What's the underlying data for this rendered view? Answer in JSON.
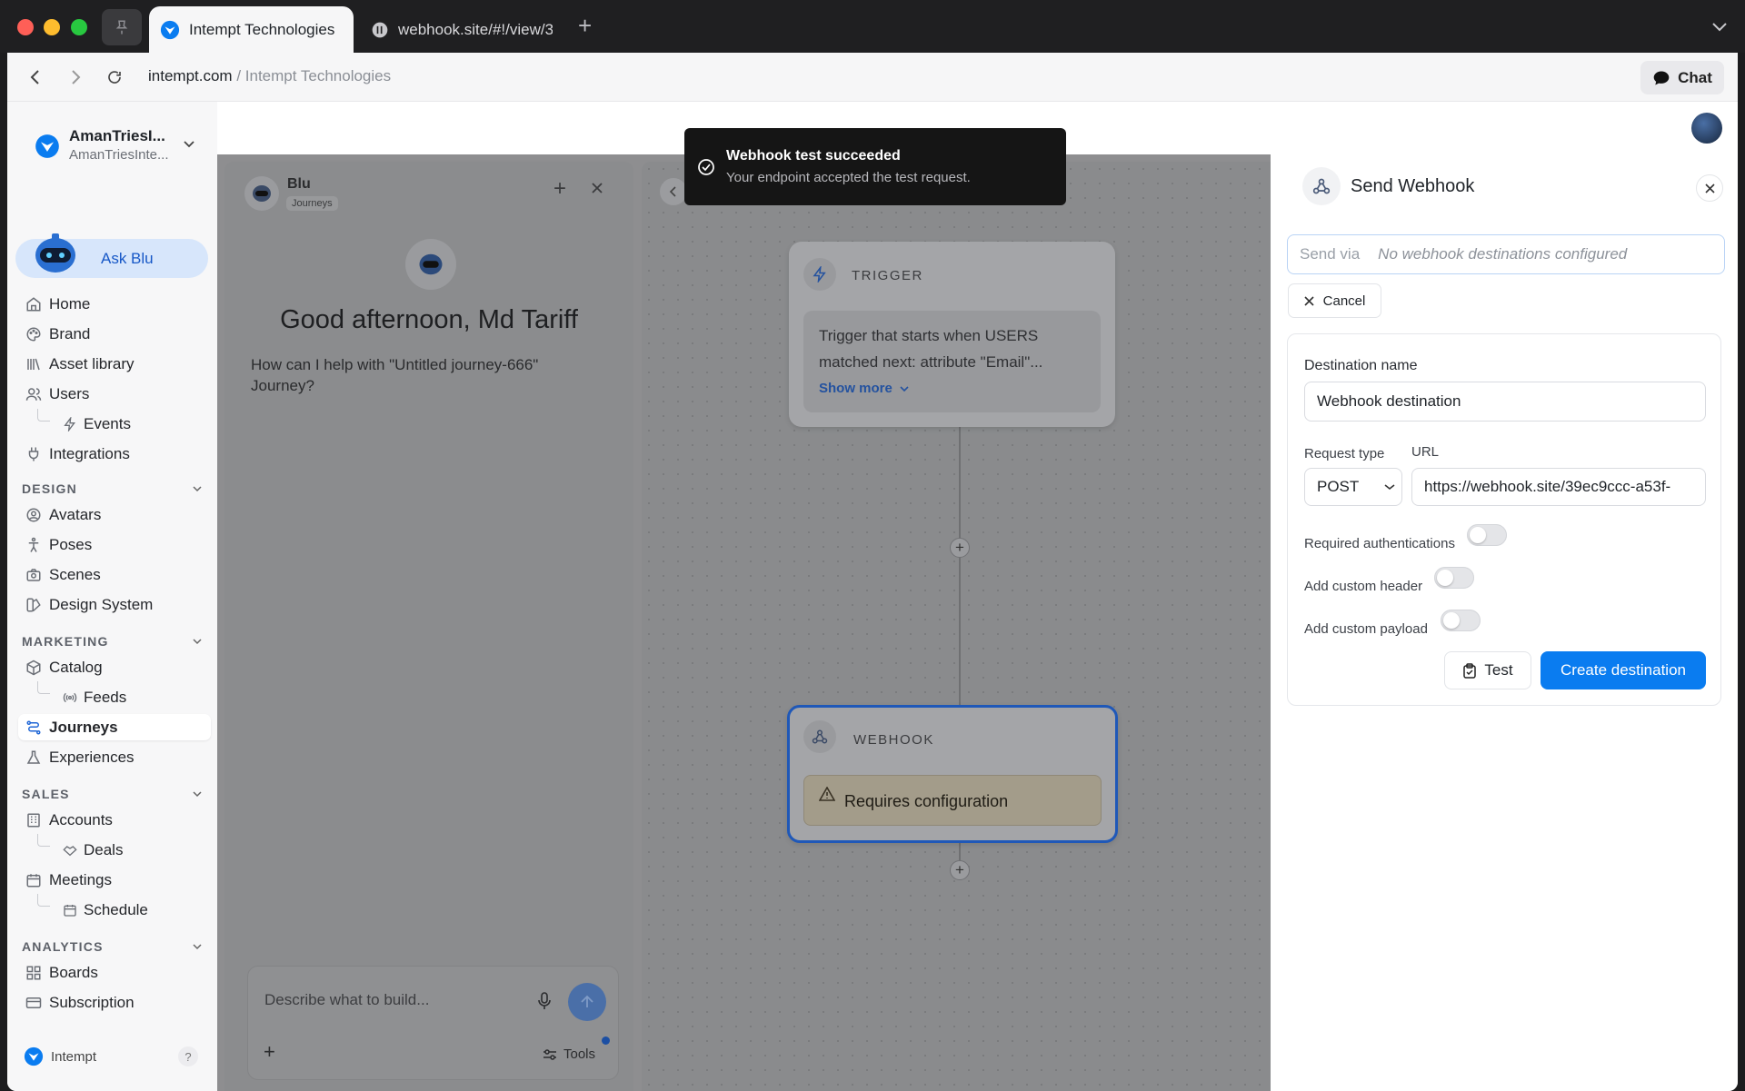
{
  "browser": {
    "tabs": [
      {
        "label": "Intempt Technologies",
        "active": true
      },
      {
        "label": "webhook.site/#!/view/3",
        "active": false
      }
    ],
    "url_domain": "intempt.com",
    "url_separator": " / ",
    "url_title": "Intempt Technologies",
    "chat_label": "Chat"
  },
  "sidebar": {
    "org_name": "AmanTriesI...",
    "org_sub": "AmanTriesInte...",
    "ask_blu": "Ask Blu",
    "items": [
      {
        "label": "Home",
        "icon": "home-icon"
      },
      {
        "label": "Brand",
        "icon": "palette-icon"
      },
      {
        "label": "Asset library",
        "icon": "library-icon"
      },
      {
        "label": "Users",
        "icon": "users-icon"
      },
      {
        "label": "Events",
        "icon": "zap-icon"
      },
      {
        "label": "Integrations",
        "icon": "plug-icon"
      }
    ],
    "sections": {
      "design": "DESIGN",
      "marketing": "MARKETING",
      "sales": "SALES",
      "analytics": "ANALYTICS"
    },
    "design_items": [
      "Avatars",
      "Poses",
      "Scenes",
      "Design System"
    ],
    "marketing_items": [
      "Catalog",
      "Feeds",
      "Journeys",
      "Experiences"
    ],
    "sales_items": [
      "Accounts",
      "Deals",
      "Meetings",
      "Schedule"
    ],
    "analytics_items": [
      "Boards",
      "Subscription"
    ],
    "footer_brand": "Intempt",
    "help": "?"
  },
  "blu": {
    "name": "Blu",
    "badge": "Journeys",
    "greeting": "Good afternoon, Md Tariff",
    "prompt": "How can I help with \"Untitled journey-666\" Journey?",
    "input_placeholder": "Describe what to build...",
    "tools_label": "Tools"
  },
  "canvas": {
    "trigger_title": "TRIGGER",
    "trigger_text_1": "Trigger that starts when USERS",
    "trigger_text_2": "matched next: attribute \"Email\"...",
    "show_more": "Show more",
    "webhook_title": "WEBHOOK",
    "webhook_status": "Requires configuration"
  },
  "toast": {
    "title": "Webhook test succeeded",
    "message": "Your endpoint accepted the test request."
  },
  "panel": {
    "title": "Send Webhook",
    "send_via_label": "Send via",
    "send_via_value": "No webhook destinations configured",
    "cancel_label": "Cancel",
    "destination_name_label": "Destination name",
    "destination_name_value": "Webhook destination",
    "request_type_label": "Request type",
    "request_type_value": "POST",
    "url_label": "URL",
    "url_value": "https://webhook.site/39ec9ccc-a53f-",
    "required_auth_label": "Required authentications",
    "custom_header_label": "Add custom header",
    "custom_payload_label": "Add custom payload",
    "test_label": "Test",
    "create_label": "Create destination"
  },
  "colors": {
    "accent": "#0a7cf0",
    "webhook_border": "#1f66d6"
  }
}
